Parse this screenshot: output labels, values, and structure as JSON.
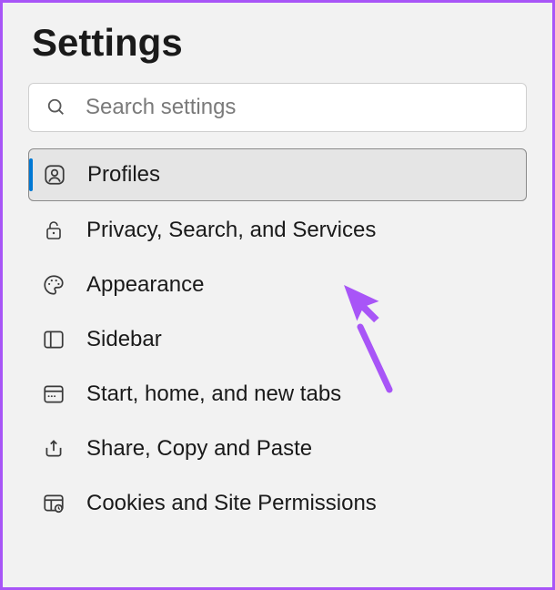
{
  "header": {
    "title": "Settings"
  },
  "search": {
    "placeholder": "Search settings"
  },
  "nav": {
    "items": [
      {
        "label": "Profiles",
        "active": true,
        "icon": "profile"
      },
      {
        "label": "Privacy, Search, and Services",
        "active": false,
        "icon": "lock"
      },
      {
        "label": "Appearance",
        "active": false,
        "icon": "palette"
      },
      {
        "label": "Sidebar",
        "active": false,
        "icon": "sidebar"
      },
      {
        "label": "Start, home, and new tabs",
        "active": false,
        "icon": "tabs"
      },
      {
        "label": "Share, Copy and Paste",
        "active": false,
        "icon": "share"
      },
      {
        "label": "Cookies and Site Permissions",
        "active": false,
        "icon": "cookies"
      }
    ]
  },
  "annotation": {
    "cursor_color": "#a855f7"
  }
}
